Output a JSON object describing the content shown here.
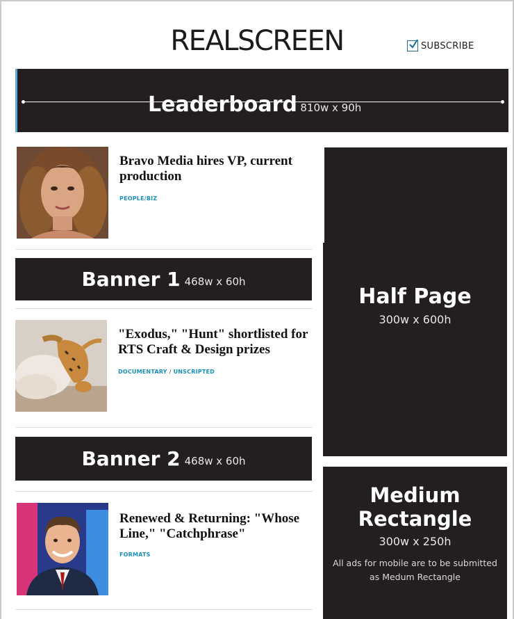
{
  "header": {
    "logo": "REALSCREEN",
    "subscribe_label": "SUBSCRIBE"
  },
  "ads": {
    "leaderboard": {
      "name": "Leaderboard",
      "size": "810w x 90h"
    },
    "banner1": {
      "name": "Banner 1",
      "size": "468w x 60h"
    },
    "banner2": {
      "name": "Banner 2",
      "size": "468w x 60h"
    },
    "half_page": {
      "name": "Half Page",
      "size": "300w x 600h"
    },
    "medium_rectangle": {
      "name_line1": "Medium",
      "name_line2": "Rectangle",
      "size": "300w x 250h",
      "note": "All ads for mobile are to be submitted as Medum Rectangle"
    }
  },
  "articles": [
    {
      "headline": "Bravo Media hires VP, current production",
      "tags": [
        "PEOPLE/BIZ"
      ]
    },
    {
      "headline": "\"Exodus,\" \"Hunt\" shortlisted for RTS Craft & Design prizes",
      "tags": [
        "DOCUMENTARY",
        "UNSCRIPTED"
      ]
    },
    {
      "headline": "Renewed & Returning: \"Whose Line,\" \"Catchphrase\"",
      "tags": [
        "FORMATS"
      ]
    }
  ],
  "tag_separator": "/",
  "colors": {
    "ad_background": "#231f20",
    "tag_blue": "#1a8fb8",
    "checkbox_blue": "#1a6aa0"
  }
}
